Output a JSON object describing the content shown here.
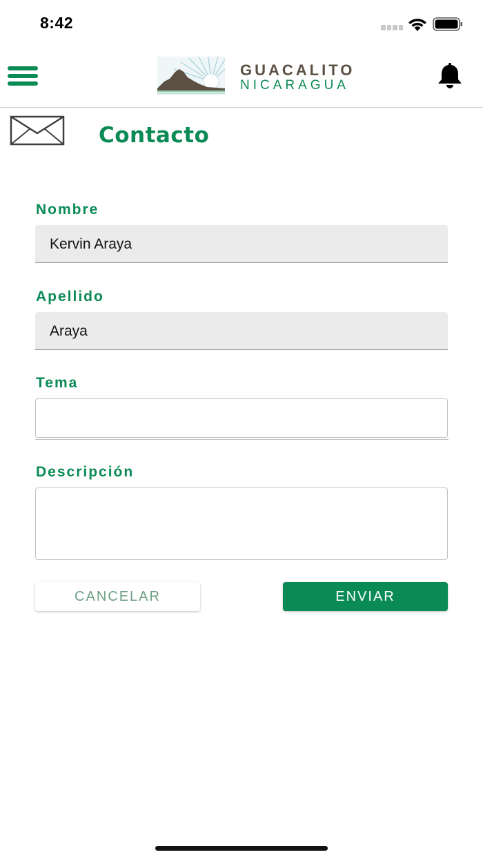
{
  "status_bar": {
    "time": "8:42",
    "icons": [
      "signal-icon",
      "wifi-icon",
      "battery-icon"
    ]
  },
  "header": {
    "menu_icon": "hamburger-menu-icon",
    "logo": {
      "line1": "GUACALITO",
      "line2": "NICARAGUA"
    },
    "notification_icon": "bell-icon"
  },
  "page": {
    "icon": "envelope-icon",
    "title": "Contacto"
  },
  "form": {
    "nombre": {
      "label": "Nombre",
      "value": "Kervin Araya"
    },
    "apellido": {
      "label": "Apellido",
      "value": "Araya"
    },
    "tema": {
      "label": "Tema",
      "value": ""
    },
    "descripcion": {
      "label": "Descripción",
      "value": ""
    }
  },
  "actions": {
    "cancel_label": "CANCELAR",
    "send_label": "ENVIAR"
  },
  "colors": {
    "accent": "#0a8a55",
    "logo_brown": "#5b5043",
    "field_bg": "#ebebeb",
    "cancel_text": "#6f9f87"
  }
}
